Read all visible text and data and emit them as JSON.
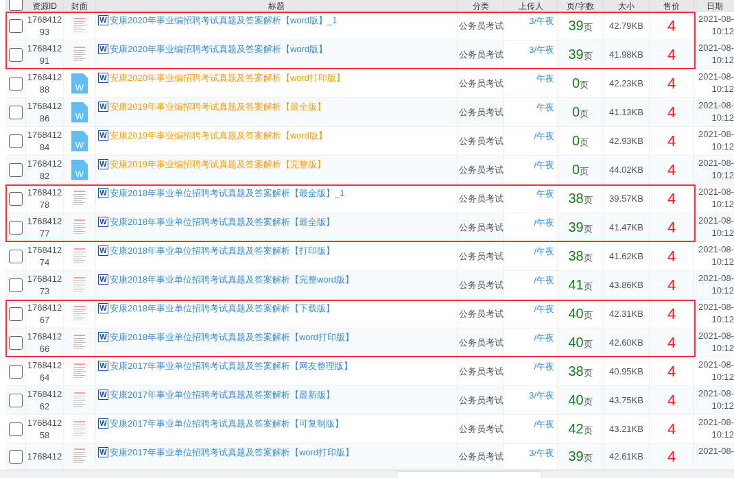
{
  "header": {
    "columns": [
      "资源ID",
      "封面",
      "标题",
      "分类",
      "上传人",
      "页/字数",
      "大小",
      "售价",
      "日期"
    ],
    "checked": false
  },
  "rows": [
    {
      "id": "176841293",
      "kind": "scan",
      "icon_letter": "W",
      "color": "#3a8ed4",
      "title": "安康2020年事业编招聘考试真题及答案解析【word版】_1",
      "category": "公务员考试",
      "uploader": "3/午夜",
      "pages": "39",
      "unit": "页",
      "size": "42.79KB",
      "price": "4",
      "date": "2021-08-",
      "time": "10:12",
      "checked": false,
      "highlighted": true
    },
    {
      "id": "176841291",
      "kind": "scan",
      "icon_letter": "W",
      "color": "#3a8ed4",
      "title": "安康2020年事业编招聘考试真题及答案解析【word版】",
      "category": "公务员考试",
      "uploader": "3/午夜",
      "pages": "39",
      "unit": "页",
      "size": "41.98KB",
      "price": "4",
      "date": "2021-08-",
      "time": "10:12",
      "checked": false,
      "highlighted": true
    },
    {
      "id": "176841288",
      "kind": "word",
      "cover_letter": "W",
      "icon_letter": "W",
      "color": "#ff9900",
      "title": "安康2020年事业编招聘考试真题及答案解析【word打印版】",
      "category": "公务员考试",
      "uploader": "午夜",
      "pages": "0",
      "unit": "页",
      "size": "42.23KB",
      "price": "4",
      "date": "2021-08-",
      "time": "10:12",
      "checked": false,
      "highlighted": false
    },
    {
      "id": "176841286",
      "kind": "word",
      "cover_letter": "W",
      "icon_letter": "W",
      "color": "#ff9900",
      "title": "安康2019年事业编招聘考试真题及答案解析【最全版】",
      "category": "公务员考试",
      "uploader": "午夜",
      "pages": "0",
      "unit": "页",
      "size": "41.13KB",
      "price": "4",
      "date": "2021-08-",
      "time": "10:12",
      "checked": false,
      "highlighted": false
    },
    {
      "id": "176841284",
      "kind": "word",
      "cover_letter": "W",
      "icon_letter": "W",
      "color": "#ff9900",
      "title": "安康2019年事业编招聘考试真题及答案解析【word版】",
      "category": "公务员考试",
      "uploader": "/午夜",
      "pages": "0",
      "unit": "页",
      "size": "42.93KB",
      "price": "4",
      "date": "2021-08-",
      "time": "10:12",
      "checked": false,
      "highlighted": false
    },
    {
      "id": "176841282",
      "kind": "word",
      "cover_letter": "W",
      "icon_letter": "W",
      "color": "#ff9900",
      "title": "安康2019年事业编招聘考试真题及答案解析【完整版】",
      "category": "公务员考试",
      "uploader": "/午夜",
      "pages": "0",
      "unit": "页",
      "size": "44.02KB",
      "price": "4",
      "date": "2021-08-",
      "time": "10:12",
      "checked": false,
      "highlighted": false
    },
    {
      "id": "176841278",
      "kind": "scan",
      "icon_letter": "W",
      "color": "#3a8ed4",
      "title": "安康2018年事业单位招聘考试真题及答案解析【最全版】_1",
      "category": "公务员考试",
      "uploader": "午夜",
      "pages": "38",
      "unit": "页",
      "size": "39.57KB",
      "price": "4",
      "date": "2021-08-",
      "time": "10:12",
      "checked": false,
      "highlighted": true
    },
    {
      "id": "176841277",
      "kind": "scan",
      "icon_letter": "W",
      "color": "#3a8ed4",
      "title": "安康2018年事业单位招聘考试真题及答案解析【最全版】",
      "category": "公务员考试",
      "uploader": "/午夜",
      "pages": "39",
      "unit": "页",
      "size": "41.47KB",
      "price": "4",
      "date": "2021-08-",
      "time": "10:12",
      "checked": false,
      "highlighted": true
    },
    {
      "id": "176841274",
      "kind": "scan",
      "icon_letter": "W",
      "color": "#3a8ed4",
      "title": "安康2018年事业单位招聘考试真题及答案解析【打印版】",
      "category": "公务员考试",
      "uploader": "/午夜",
      "pages": "38",
      "unit": "页",
      "size": "41.62KB",
      "price": "4",
      "date": "2021-08-",
      "time": "10:12",
      "checked": false,
      "highlighted": false
    },
    {
      "id": "176841273",
      "kind": "scan",
      "icon_letter": "W",
      "color": "#3a8ed4",
      "title": "安康2018年事业单位招聘考试真题及答案解析【完整word版】",
      "category": "公务员考试",
      "uploader": "/午夜",
      "pages": "41",
      "unit": "页",
      "size": "43.86KB",
      "price": "4",
      "date": "2021-08-",
      "time": "10:12",
      "checked": false,
      "highlighted": false
    },
    {
      "id": "176841267",
      "kind": "scan",
      "icon_letter": "W",
      "color": "#3a8ed4",
      "title": "安康2018年事业单位招聘考试真题及答案解析【下载版】",
      "category": "公务员考试",
      "uploader": "/午夜",
      "pages": "40",
      "unit": "页",
      "size": "42.31KB",
      "price": "4",
      "date": "2021-08-",
      "time": "10:12",
      "checked": false,
      "highlighted": true
    },
    {
      "id": "176841266",
      "kind": "scan",
      "icon_letter": "W",
      "color": "#3a8ed4",
      "title": "安康2018年事业单位招聘考试真题及答案解析【word打印版】",
      "category": "公务员考试",
      "uploader": "/午夜",
      "pages": "40",
      "unit": "页",
      "size": "42.60KB",
      "price": "4",
      "date": "2021-08-",
      "time": "10:12",
      "checked": false,
      "highlighted": true
    },
    {
      "id": "176841264",
      "kind": "scan",
      "icon_letter": "W",
      "color": "#3a8ed4",
      "title": "安康2017年事业单位招聘考试真题及答案解析【网友整理版】",
      "category": "公务员考试",
      "uploader": "/午夜",
      "pages": "38",
      "unit": "页",
      "size": "40.95KB",
      "price": "4",
      "date": "2021-08-",
      "time": "10:12",
      "checked": false,
      "highlighted": false
    },
    {
      "id": "176841262",
      "kind": "scan",
      "icon_letter": "W",
      "color": "#3a8ed4",
      "title": "安康2017年事业单位招聘考试真题及答案解析【最新版】",
      "category": "公务员考试",
      "uploader": "3/午夜",
      "pages": "40",
      "unit": "页",
      "size": "43.75KB",
      "price": "4",
      "date": "2021-08-",
      "time": "10:12",
      "checked": false,
      "highlighted": false
    },
    {
      "id": "176841258",
      "kind": "scan",
      "icon_letter": "W",
      "color": "#3a8ed4",
      "title": "安康2017年事业单位招聘考试真题及答案解析【可复制版】",
      "category": "公务员考试",
      "uploader": "/午夜",
      "pages": "42",
      "unit": "页",
      "size": "43.21KB",
      "price": "4",
      "date": "2021-08-",
      "time": "10:12",
      "checked": false,
      "highlighted": false
    },
    {
      "id": "1768412",
      "kind": "scan",
      "icon_letter": "W",
      "color": "#3a8ed4",
      "title": "安康2017年事业单位招聘考试真题及答案解析【word打印版】",
      "category": "公务员考试",
      "uploader": "3/午夜",
      "pages": "39",
      "unit": "页",
      "size": "42.61KB",
      "price": "4",
      "date": "2021-08-",
      "checked": false,
      "highlighted": false
    }
  ]
}
